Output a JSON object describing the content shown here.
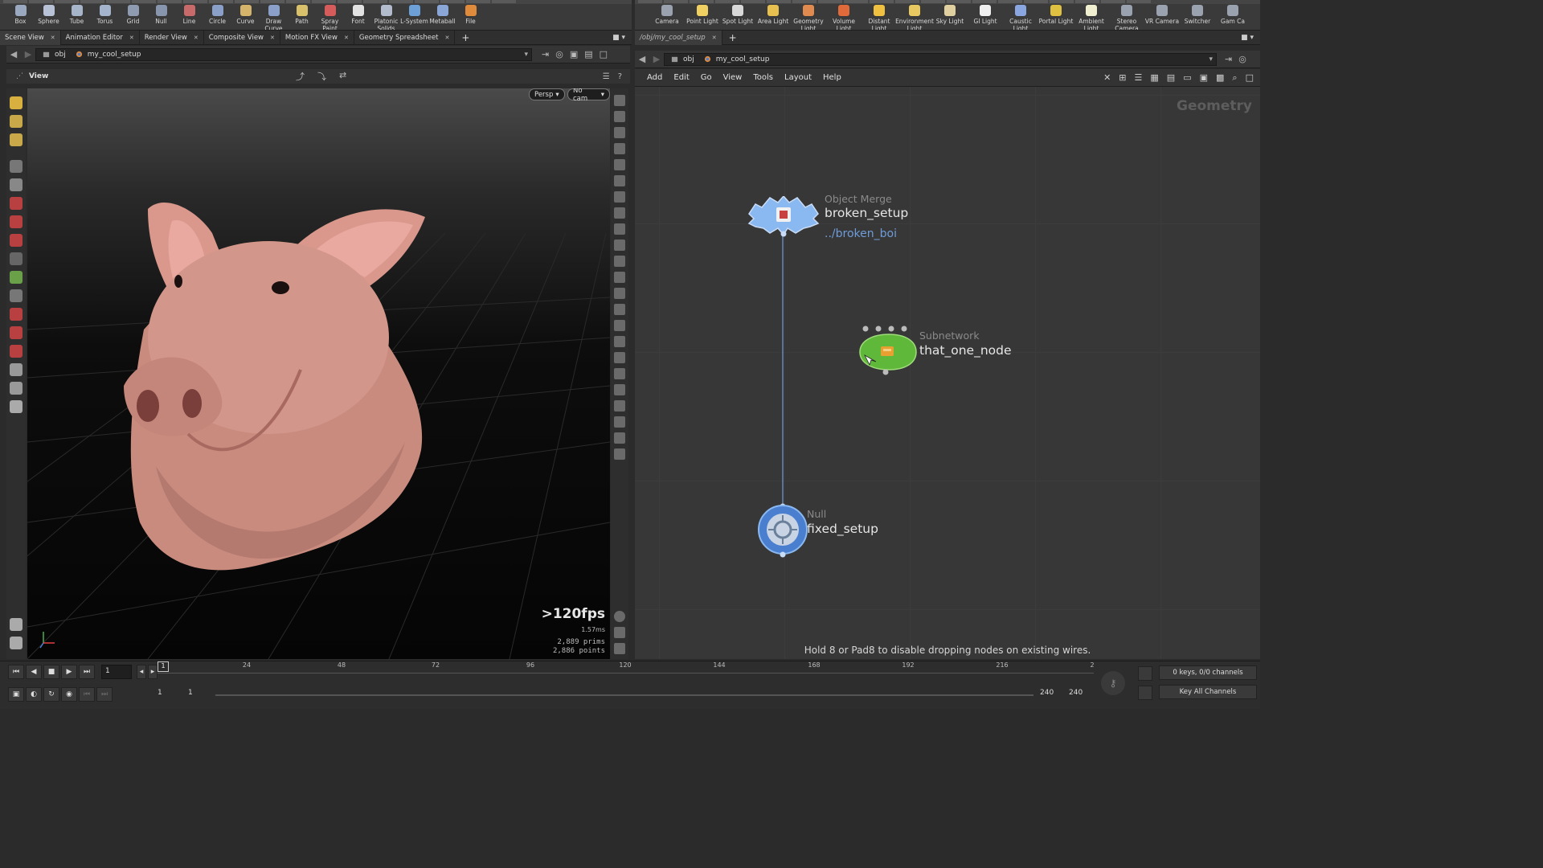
{
  "left_shelf": {
    "tools": [
      {
        "label": "Box",
        "color": "#9aa9c0"
      },
      {
        "label": "Sphere",
        "color": "#b8c2d6"
      },
      {
        "label": "Tube",
        "color": "#a7b5ca"
      },
      {
        "label": "Torus",
        "color": "#a3b4cc"
      },
      {
        "label": "Grid",
        "color": "#8f9bb0"
      },
      {
        "label": "Null",
        "color": "#8796ad"
      },
      {
        "label": "Line",
        "color": "#c96a6a"
      },
      {
        "label": "Circle",
        "color": "#8aa0c8"
      },
      {
        "label": "Curve",
        "color": "#d4b36a"
      },
      {
        "label": "Draw Curve",
        "color": "#8aa0c8"
      },
      {
        "label": "Path",
        "color": "#d9c06a"
      },
      {
        "label": "Spray Paint",
        "color": "#d65b5b"
      },
      {
        "label": "Font",
        "color": "#e2e2e2"
      },
      {
        "label": "Platonic Solids",
        "color": "#b2bccd"
      },
      {
        "label": "L-System",
        "color": "#6ea0d8"
      },
      {
        "label": "Metaball",
        "color": "#8aa6d6"
      },
      {
        "label": "File",
        "color": "#e08a3c"
      }
    ]
  },
  "right_shelf": {
    "tools": [
      {
        "label": "Camera",
        "color": "#9aa2b0"
      },
      {
        "label": "Point Light",
        "color": "#f0d060"
      },
      {
        "label": "Spot Light",
        "color": "#d8d8d8"
      },
      {
        "label": "Area Light",
        "color": "#e8c050"
      },
      {
        "label": "Geometry Light",
        "color": "#e08a50"
      },
      {
        "label": "Volume Light",
        "color": "#e06a3a"
      },
      {
        "label": "Distant Light",
        "color": "#f0c040"
      },
      {
        "label": "Environment Light",
        "color": "#e8c860"
      },
      {
        "label": "Sky Light",
        "color": "#e0d0a0"
      },
      {
        "label": "GI Light",
        "color": "#f0f0f0"
      },
      {
        "label": "Caustic Light",
        "color": "#8aa6e0"
      },
      {
        "label": "Portal Light",
        "color": "#e0c040"
      },
      {
        "label": "Ambient Light",
        "color": "#f0f0d0"
      },
      {
        "label": "Stereo Camera",
        "color": "#9aa2b0"
      },
      {
        "label": "VR Camera",
        "color": "#9aa2b0"
      },
      {
        "label": "Switcher",
        "color": "#9aa2b0"
      },
      {
        "label": "Gam Ca",
        "color": "#9aa2b0"
      }
    ]
  },
  "left_pane_tabs": [
    "Scene View",
    "Animation Editor",
    "Render View",
    "Composite View",
    "Motion FX View",
    "Geometry Spreadsheet"
  ],
  "right_pane_tabs": [
    "/obj/my_cool_setup"
  ],
  "left_path": {
    "root": "obj",
    "current": "my_cool_setup"
  },
  "right_path": {
    "root": "obj",
    "current": "my_cool_setup"
  },
  "viewer": {
    "title": "View",
    "persp_label": "Persp",
    "cam_label": "No cam",
    "fps": ">120fps",
    "frame_time": "1.57ms",
    "prims": "2,889  prims",
    "points": "2,886 points"
  },
  "network_menu": [
    "Add",
    "Edit",
    "Go",
    "View",
    "Tools",
    "Layout",
    "Help"
  ],
  "network": {
    "context": "Geometry",
    "nodes": [
      {
        "type": "Object Merge",
        "name": "broken_setup",
        "param": "../broken_boi"
      },
      {
        "type": "Subnetwork",
        "name": "that_one_node"
      },
      {
        "type": "Null",
        "name": "fixed_setup"
      }
    ],
    "hint": "Hold 8 or Pad8 to disable dropping nodes on existing wires."
  },
  "timeline": {
    "current_frame": "1",
    "frame_field": "1",
    "ticks": [
      "24",
      "48",
      "72",
      "96",
      "120",
      "144",
      "168",
      "192",
      "216",
      "2"
    ],
    "range_start": "1",
    "range_start2": "1",
    "range_end": "240",
    "range_end2": "240",
    "keys_status": "0 keys, 0/0 channels",
    "key_all": "Key All Channels"
  },
  "colors": {
    "accent_blue": "#6f9cd8",
    "merge_node": "#8ab8f0",
    "subnet_node": "#5fb83a",
    "null_node": "#4a7fd0"
  }
}
